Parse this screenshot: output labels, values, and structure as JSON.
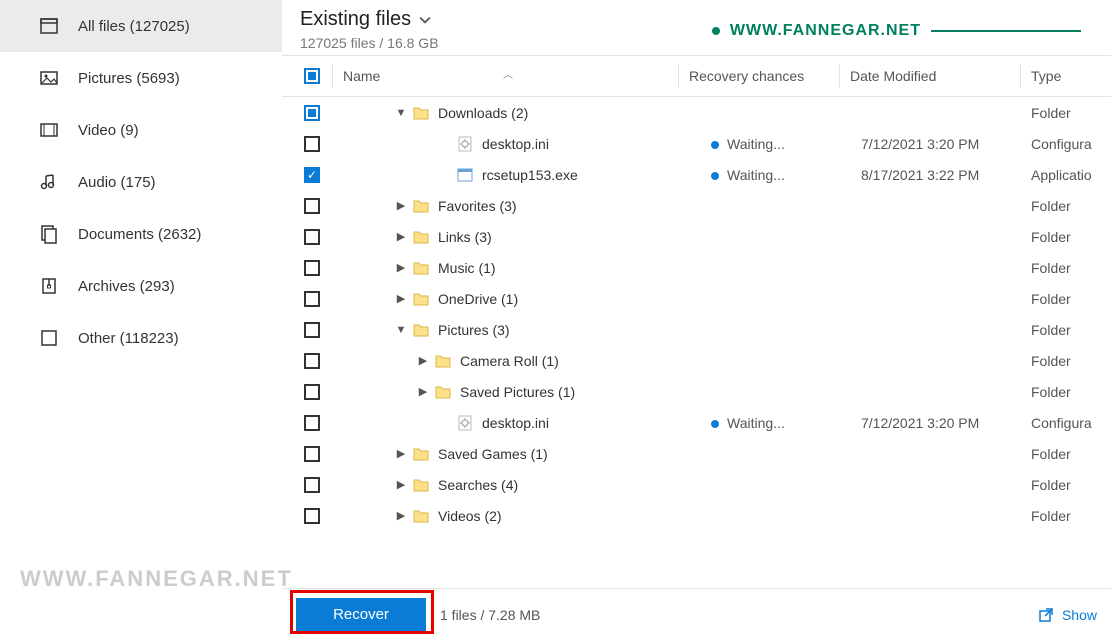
{
  "watermark": {
    "top": "WWW.FANNEGAR.NET",
    "bottom": "WWW.FANNEGAR.NET"
  },
  "sidebar": {
    "items": [
      {
        "label": "All files (127025)",
        "icon": "all-files",
        "active": true
      },
      {
        "label": "Pictures (5693)",
        "icon": "pictures",
        "active": false
      },
      {
        "label": "Video (9)",
        "icon": "video",
        "active": false
      },
      {
        "label": "Audio (175)",
        "icon": "audio",
        "active": false
      },
      {
        "label": "Documents (2632)",
        "icon": "documents",
        "active": false
      },
      {
        "label": "Archives (293)",
        "icon": "archives",
        "active": false
      },
      {
        "label": "Other (118223)",
        "icon": "other",
        "active": false
      }
    ]
  },
  "header": {
    "title": "Existing files",
    "subtitle": "127025 files / 16.8 GB"
  },
  "columns": {
    "name": "Name",
    "recovery": "Recovery chances",
    "date": "Date Modified",
    "type": "Type"
  },
  "rows": [
    {
      "indent": 1,
      "expander": "down",
      "icon": "folder",
      "name": "Downloads (2)",
      "checked": "header",
      "recovery": "",
      "date": "",
      "type": "Folder"
    },
    {
      "indent": 3,
      "expander": "",
      "icon": "ini",
      "name": "desktop.ini",
      "checked": false,
      "recovery": "Waiting...",
      "date": "7/12/2021 3:20 PM",
      "type": "Configura"
    },
    {
      "indent": 3,
      "expander": "",
      "icon": "exe",
      "name": "rcsetup153.exe",
      "checked": true,
      "recovery": "Waiting...",
      "date": "8/17/2021 3:22 PM",
      "type": "Applicatio"
    },
    {
      "indent": 1,
      "expander": "right",
      "icon": "folder",
      "name": "Favorites (3)",
      "checked": false,
      "recovery": "",
      "date": "",
      "type": "Folder"
    },
    {
      "indent": 1,
      "expander": "right",
      "icon": "folder",
      "name": "Links (3)",
      "checked": false,
      "recovery": "",
      "date": "",
      "type": "Folder"
    },
    {
      "indent": 1,
      "expander": "right",
      "icon": "folder",
      "name": "Music (1)",
      "checked": false,
      "recovery": "",
      "date": "",
      "type": "Folder"
    },
    {
      "indent": 1,
      "expander": "right",
      "icon": "folder",
      "name": "OneDrive (1)",
      "checked": false,
      "recovery": "",
      "date": "",
      "type": "Folder"
    },
    {
      "indent": 1,
      "expander": "down",
      "icon": "folder",
      "name": "Pictures (3)",
      "checked": false,
      "recovery": "",
      "date": "",
      "type": "Folder"
    },
    {
      "indent": 2,
      "expander": "right",
      "icon": "folder",
      "name": "Camera Roll (1)",
      "checked": false,
      "recovery": "",
      "date": "",
      "type": "Folder"
    },
    {
      "indent": 2,
      "expander": "right",
      "icon": "folder",
      "name": "Saved Pictures (1)",
      "checked": false,
      "recovery": "",
      "date": "",
      "type": "Folder"
    },
    {
      "indent": 3,
      "expander": "",
      "icon": "ini",
      "name": "desktop.ini",
      "checked": false,
      "recovery": "Waiting...",
      "date": "7/12/2021 3:20 PM",
      "type": "Configura"
    },
    {
      "indent": 1,
      "expander": "right",
      "icon": "folder",
      "name": "Saved Games (1)",
      "checked": false,
      "recovery": "",
      "date": "",
      "type": "Folder"
    },
    {
      "indent": 1,
      "expander": "right",
      "icon": "folder",
      "name": "Searches (4)",
      "checked": false,
      "recovery": "",
      "date": "",
      "type": "Folder"
    },
    {
      "indent": 1,
      "expander": "right",
      "icon": "folder",
      "name": "Videos (2)",
      "checked": false,
      "recovery": "",
      "date": "",
      "type": "Folder"
    }
  ],
  "footer": {
    "button": "Recover",
    "info": "1 files / 7.28 MB",
    "show": "Show"
  }
}
